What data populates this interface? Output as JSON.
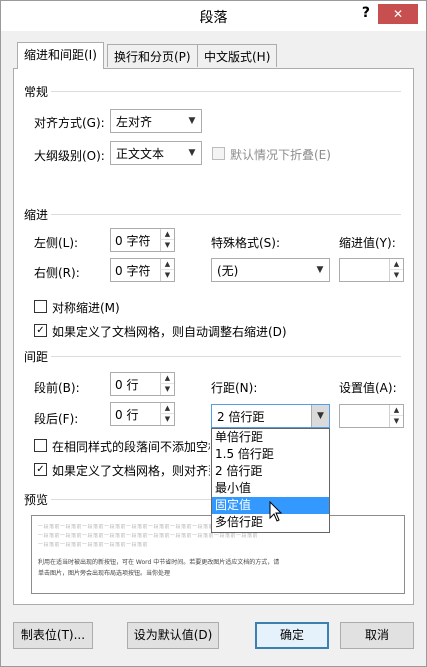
{
  "window": {
    "title": "段落",
    "help_label": "?",
    "close_label": "✕"
  },
  "tabs": [
    {
      "label": "缩进和间距(I)",
      "active": true
    },
    {
      "label": "换行和分页(P)",
      "active": false
    },
    {
      "label": "中文版式(H)",
      "active": false
    }
  ],
  "general": {
    "heading": "常规",
    "alignment_label": "对齐方式(G):",
    "alignment_value": "左对齐",
    "outline_label": "大纲级别(O):",
    "outline_value": "正文文本",
    "collapse_label": "默认情况下折叠(E)"
  },
  "indent": {
    "heading": "缩进",
    "left_label": "左侧(L):",
    "left_value": "0 字符",
    "right_label": "右侧(R):",
    "right_value": "0 字符",
    "special_label": "特殊格式(S):",
    "special_value": "(无)",
    "by_label": "缩进值(Y):",
    "by_value": "",
    "mirror_label": "对称缩进(M)",
    "grid_adjust_label": "如果定义了文档网格，则自动调整右缩进(D)"
  },
  "spacing": {
    "heading": "间距",
    "before_label": "段前(B):",
    "before_value": "0 行",
    "after_label": "段后(F):",
    "after_value": "0 行",
    "line_label": "行距(N):",
    "line_value": "2 倍行距",
    "at_label": "设置值(A):",
    "at_value": "",
    "no_space_label": "在相同样式的段落间不添加空格",
    "snap_grid_label": "如果定义了文档网格，则对齐到网格",
    "line_options": [
      "单倍行距",
      "1.5 倍行距",
      "2 倍行距",
      "最小值",
      "固定值",
      "多倍行距"
    ],
    "highlighted_option": "固定值"
  },
  "preview": {
    "heading": "预览",
    "prev_line1": "一段落前一段落前一段落前一段落前一段落前一段落前一段落前一段落前一段落前一段落前",
    "prev_line2": "一段落前一段落前一段落前一段落前一段落前一段落前一段落前一段落前一段落前一段落前",
    "prev_line3": "一段落前一段落前一段落前一段落前一段落前",
    "sample_line1": "利用在适当时被出现的新按钮，可在 Word 中节省时间。若要更改图片适应文档的方式，请",
    "sample_line2": "单击图片，图片旁会出现布局选项按钮。当你处理"
  },
  "buttons": {
    "tabs": "制表位(T)...",
    "set_default": "设为默认值(D)",
    "ok": "确定",
    "cancel": "取消"
  }
}
